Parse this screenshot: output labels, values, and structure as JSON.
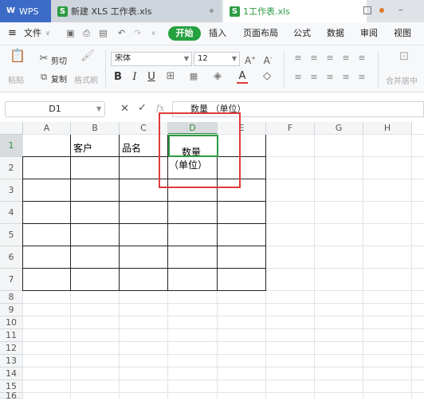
{
  "tabs": {
    "wps_label": "WPS",
    "doc1_label": "新建 XLS 工作表.xls",
    "doc2_label": "1工作表.xls"
  },
  "menubar": {
    "file": "文件",
    "kaishi": "开始",
    "insert": "插入",
    "page_layout": "页面布局",
    "formula": "公式",
    "data": "数据",
    "review": "审阅",
    "view": "视图"
  },
  "ribbon": {
    "cut": "剪切",
    "copy": "复制",
    "paste": "粘贴",
    "format_painter": "格式刷",
    "font_name": "宋体",
    "font_size": "12",
    "merge_center": "合并居中"
  },
  "formula_bar": {
    "name_box": "D1",
    "fx": "fx",
    "content": "数量  （单位）"
  },
  "sheet": {
    "columns": [
      "A",
      "B",
      "C",
      "D",
      "E",
      "F",
      "G",
      "H"
    ],
    "rows": [
      "1",
      "2",
      "3",
      "4",
      "5",
      "6",
      "7",
      "8",
      "9",
      "10",
      "11",
      "12",
      "13",
      "14",
      "15",
      "16"
    ],
    "selected_column": "D",
    "selected_row": "1",
    "cells": {
      "B1": "客户",
      "C1": "品名",
      "D1_line1": "数量",
      "D1_line2": "（单位）"
    }
  },
  "colors": {
    "accent_green": "#2e9b43",
    "wps_blue": "#3b6bc6",
    "highlight_red": "#e03a3a"
  }
}
